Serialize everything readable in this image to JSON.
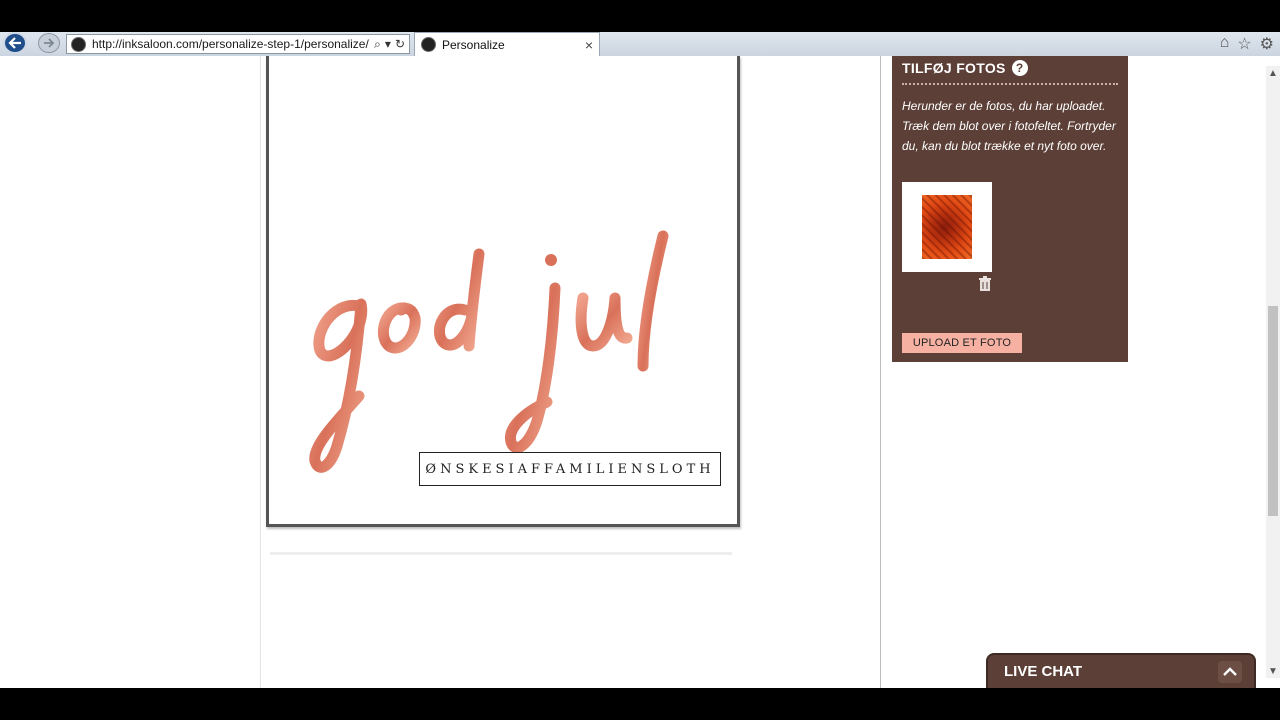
{
  "browser": {
    "url": "http://inksaloon.com/personalize-step-1/personalize/",
    "tab_title": "Personalize",
    "tab_close": "×",
    "search_icon": "search-icon",
    "refresh_icon": "refresh-icon"
  },
  "card": {
    "script_text": "god jul",
    "caption": "ØNSKESIAFFAMILIENSLOTH",
    "script_color": "#e0826a"
  },
  "sidebar": {
    "title": "TILFØJ FOTOS",
    "help": "?",
    "description": "Herunder er de fotos, du har uploadet. Træk dem blot over i fotofeltet. Fortryder du, kan du blot trække et nyt foto over.",
    "upload_label": "UPLOAD ET FOTO",
    "background_color": "#5c4038",
    "button_color": "#f6b1a2"
  },
  "livechat": {
    "label": "LIVE CHAT"
  }
}
